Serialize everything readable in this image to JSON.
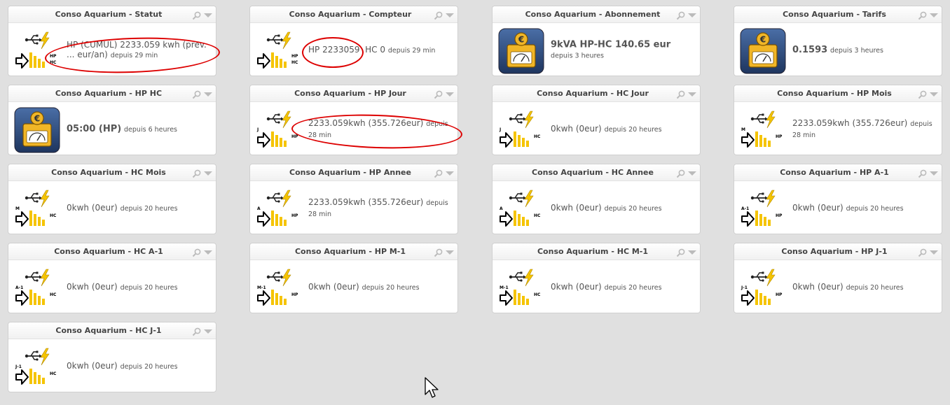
{
  "widgets": [
    {
      "title": "Conso Aquarium - Statut",
      "icon": "meter-icon",
      "rowTop": "HP",
      "rowBottom": "HC",
      "leftLabel": "",
      "value": "HP (CUMUL) 2233.059 kwh (prev. ... eur/an)",
      "valueBold": false,
      "since": "depuis 29 min"
    },
    {
      "title": "Conso Aquarium - Compteur",
      "icon": "meter-icon",
      "rowTop": "HP",
      "rowBottom": "HC",
      "leftLabel": "",
      "value": "HP 2233059  HC 0",
      "valueBold": false,
      "since": "depuis 29 min"
    },
    {
      "title": "Conso Aquarium - Abonnement",
      "icon": "euro-gauge-icon",
      "value": "9kVA HP-HC 140.65 eur",
      "valueBold": true,
      "since": "depuis 3 heures"
    },
    {
      "title": "Conso Aquarium - Tarifs",
      "icon": "euro-gauge-icon",
      "value": "0.1593",
      "valueBold": true,
      "since": "depuis 3 heures"
    },
    {
      "title": "Conso Aquarium - HP HC",
      "icon": "euro-gauge-icon",
      "value": "05:00 (HP)",
      "valueBold": true,
      "since": "depuis 6 heures"
    },
    {
      "title": "Conso Aquarium - HP Jour",
      "icon": "meter-icon",
      "rowTop": "",
      "rowBottom": "HP",
      "leftLabel": "J",
      "value": "2233.059kwh (355.726eur)",
      "valueBold": false,
      "since": "depuis 28 min"
    },
    {
      "title": "Conso Aquarium - HC Jour",
      "icon": "meter-icon",
      "rowTop": "",
      "rowBottom": "HC",
      "leftLabel": "J",
      "value": "0kwh (0eur)",
      "valueBold": false,
      "since": "depuis 20 heures"
    },
    {
      "title": "Conso Aquarium - HP Mois",
      "icon": "meter-icon",
      "rowTop": "",
      "rowBottom": "HP",
      "leftLabel": "M",
      "value": "2233.059kwh (355.726eur)",
      "valueBold": false,
      "since": "depuis 28 min"
    },
    {
      "title": "Conso Aquarium - HC Mois",
      "icon": "meter-icon",
      "rowTop": "",
      "rowBottom": "HC",
      "leftLabel": "M",
      "value": "0kwh (0eur)",
      "valueBold": false,
      "since": "depuis 20 heures"
    },
    {
      "title": "Conso Aquarium - HP Annee",
      "icon": "meter-icon",
      "rowTop": "",
      "rowBottom": "HP",
      "leftLabel": "A",
      "value": "2233.059kwh (355.726eur)",
      "valueBold": false,
      "since": "depuis 28 min"
    },
    {
      "title": "Conso Aquarium - HC Annee",
      "icon": "meter-icon",
      "rowTop": "",
      "rowBottom": "HC",
      "leftLabel": "A",
      "value": "0kwh (0eur)",
      "valueBold": false,
      "since": "depuis 20 heures"
    },
    {
      "title": "Conso Aquarium - HP A-1",
      "icon": "meter-icon",
      "rowTop": "",
      "rowBottom": "HP",
      "leftLabel": "A-1",
      "value": "0kwh (0eur)",
      "valueBold": false,
      "since": "depuis 20 heures"
    },
    {
      "title": "Conso Aquarium - HC A-1",
      "icon": "meter-icon",
      "rowTop": "",
      "rowBottom": "HC",
      "leftLabel": "A-1",
      "value": "0kwh (0eur)",
      "valueBold": false,
      "since": "depuis 20 heures"
    },
    {
      "title": "Conso Aquarium - HP M-1",
      "icon": "meter-icon",
      "rowTop": "",
      "rowBottom": "HP",
      "leftLabel": "M-1",
      "value": "0kwh (0eur)",
      "valueBold": false,
      "since": "depuis 20 heures"
    },
    {
      "title": "Conso Aquarium - HC M-1",
      "icon": "meter-icon",
      "rowTop": "",
      "rowBottom": "HC",
      "leftLabel": "M-1",
      "value": "0kwh (0eur)",
      "valueBold": false,
      "since": "depuis 20 heures"
    },
    {
      "title": "Conso Aquarium - HP J-1",
      "icon": "meter-icon",
      "rowTop": "",
      "rowBottom": "HP",
      "leftLabel": "J-1",
      "value": "0kwh (0eur)",
      "valueBold": false,
      "since": "depuis 20 heures"
    },
    {
      "title": "Conso Aquarium - HC J-1",
      "icon": "meter-icon",
      "rowTop": "",
      "rowBottom": "HC",
      "leftLabel": "J-1",
      "value": "0kwh (0eur)",
      "valueBold": false,
      "since": "depuis 20 heures"
    }
  ],
  "colors": {
    "background": "#e0e0e0",
    "highlight": "#dd0000",
    "accent_yellow": "#f5c400",
    "euro_blue": "#2e4a78"
  },
  "header_icons": [
    "search-icon",
    "chevron-down-icon"
  ]
}
